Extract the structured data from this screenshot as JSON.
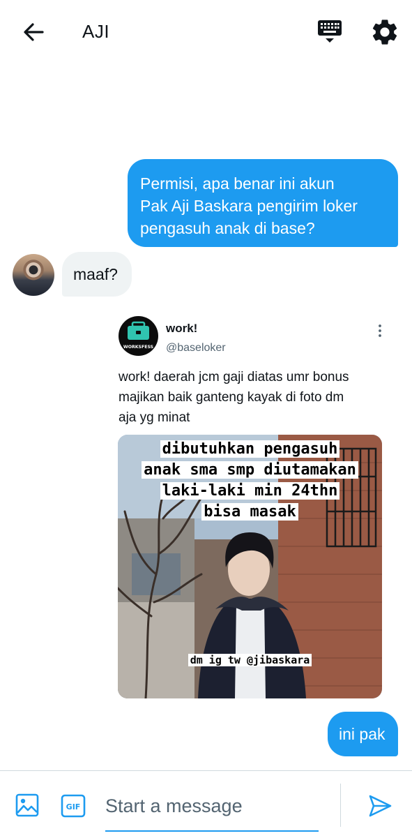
{
  "header": {
    "title": "AJI",
    "icons": {
      "back": "arrow-left-icon",
      "keyboard": "keyboard-icon",
      "settings": "gear-icon"
    }
  },
  "messages": {
    "outgoing_1": {
      "lines": [
        "Permisi, apa benar ini akun",
        "Pak Aji Baskara pengirim loker",
        "pengasuh anak di base?"
      ]
    },
    "incoming_1": {
      "text": "maaf?"
    },
    "outgoing_2": {
      "text": "ini pak"
    }
  },
  "shared_tweet": {
    "name": "work!",
    "handle": "@baseloker",
    "avatar_label": "WORKSFESS",
    "text_lines": [
      "work! daerah jcm gaji diatas umr bonus",
      "majikan baik ganteng kayak di foto dm",
      "aja yg minat"
    ],
    "image_caption_lines": [
      "dibutuhkan pengasuh",
      "anak sma smp diutamakan",
      "laki-laki min 24thn",
      "bisa masak"
    ],
    "image_footer_caption": "dm ig tw @jibaskara"
  },
  "composer": {
    "placeholder": "Start a message",
    "gif_label": "GIF",
    "icons": {
      "image": "image-icon",
      "gif": "gif-icon",
      "send": "send-icon"
    }
  },
  "colors": {
    "accent": "#1d9bf0",
    "incoming_bubble": "#eff3f4",
    "text": "#0f1419",
    "secondary_text": "#536471"
  }
}
